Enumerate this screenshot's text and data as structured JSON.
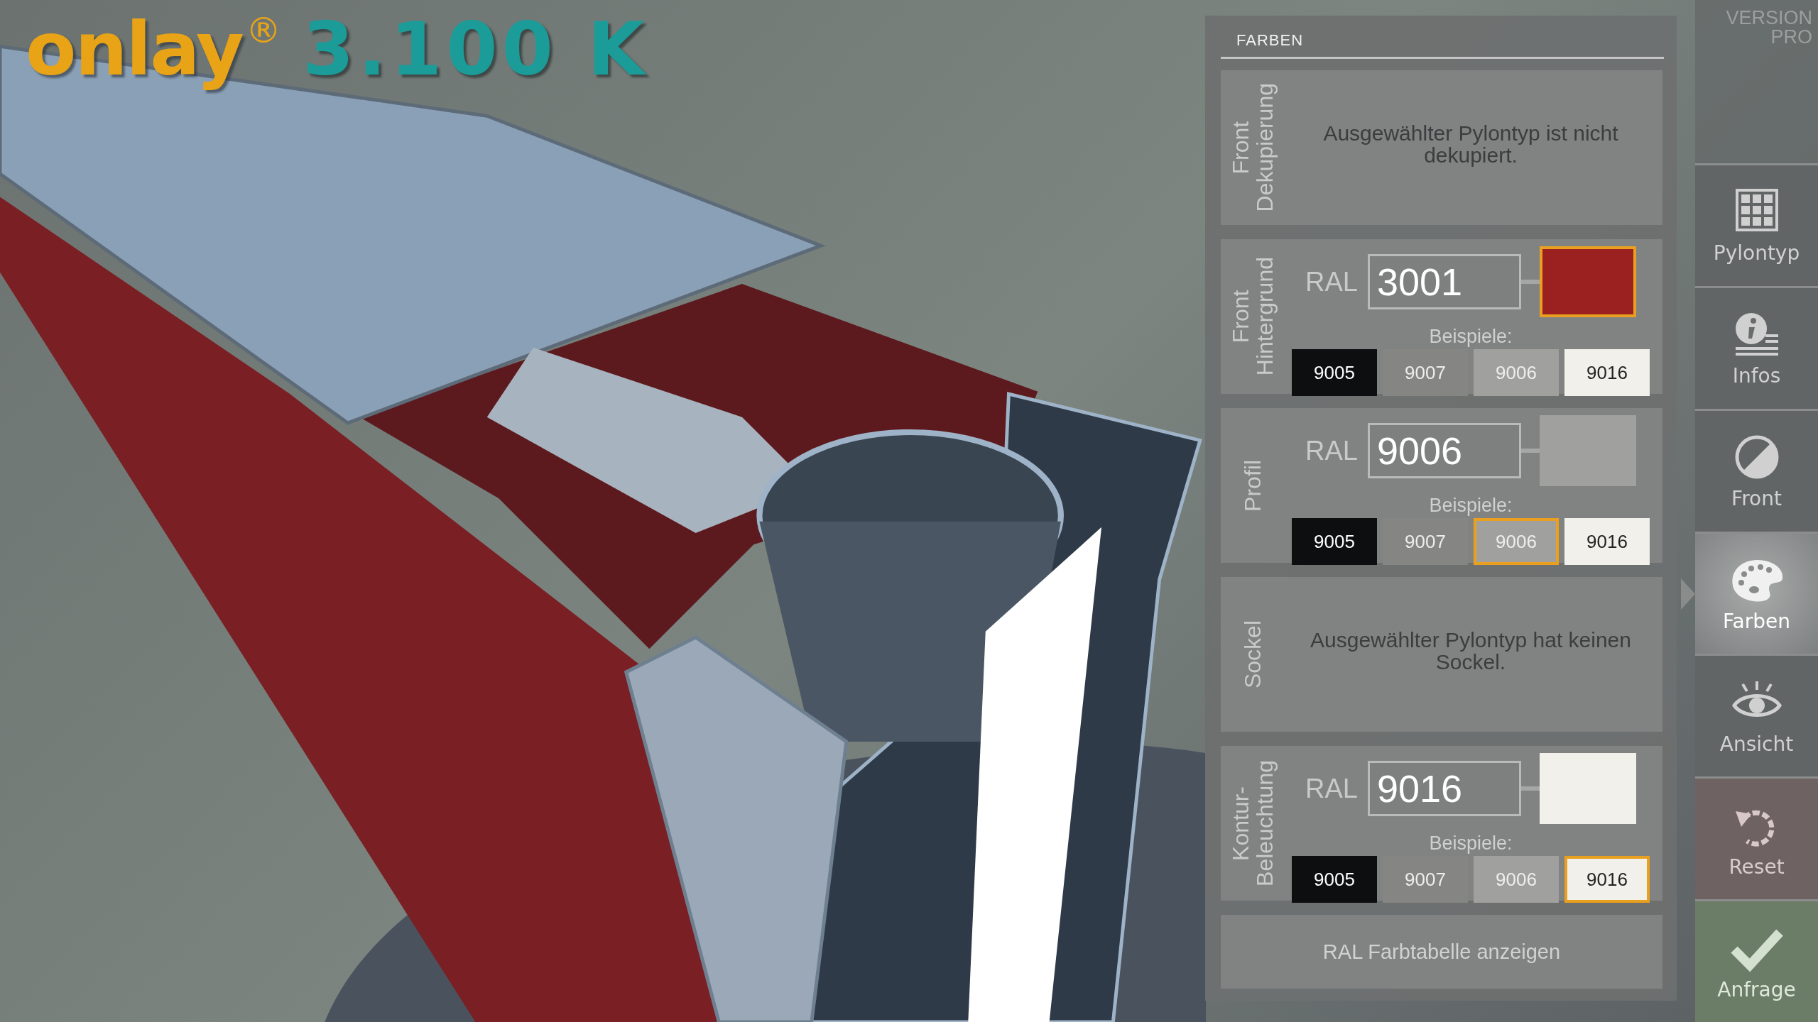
{
  "logo": {
    "brand": "onlay",
    "mark": "®",
    "model": "3.100 K"
  },
  "edition": [
    "VERSION",
    "PRO"
  ],
  "panel": {
    "title": "FARBEN",
    "sections": [
      {
        "kind": "message",
        "label": [
          "Front",
          "Dekupierung"
        ],
        "message": "Ausgewählter Pylontyp ist nicht dekupiert."
      },
      {
        "kind": "color",
        "label": [
          "Front",
          "Hintergrund"
        ],
        "ral_label": "RAL",
        "value": "3001",
        "color": "#9b2121",
        "swatch_selected": true,
        "examples_label": "Beispiele:",
        "examples": [
          {
            "label": "9005",
            "color": "#0d0e10",
            "selected": false
          },
          {
            "label": "9007",
            "color": "#858583",
            "selected": false
          },
          {
            "label": "9006",
            "color": "#a0a19f",
            "selected": false
          },
          {
            "label": "9016",
            "color": "#f1f0ea",
            "selected": false
          }
        ]
      },
      {
        "kind": "color",
        "label": [
          "Profil"
        ],
        "ral_label": "RAL",
        "value": "9006",
        "color": "#a0a19f",
        "swatch_selected": false,
        "examples_label": "Beispiele:",
        "examples": [
          {
            "label": "9005",
            "color": "#0d0e10",
            "selected": false
          },
          {
            "label": "9007",
            "color": "#858583",
            "selected": false
          },
          {
            "label": "9006",
            "color": "#a0a19f",
            "selected": true
          },
          {
            "label": "9016",
            "color": "#f1f0ea",
            "selected": false
          }
        ]
      },
      {
        "kind": "message",
        "label": [
          "Sockel"
        ],
        "message": "Ausgewählter Pylontyp hat keinen Sockel."
      },
      {
        "kind": "color",
        "label": [
          "Kontur-",
          "Beleuchtung"
        ],
        "ral_label": "RAL",
        "value": "9016",
        "color": "#f1f0ea",
        "swatch_selected": false,
        "examples_label": "Beispiele:",
        "examples": [
          {
            "label": "9005",
            "color": "#0d0e10",
            "selected": false
          },
          {
            "label": "9007",
            "color": "#858583",
            "selected": false
          },
          {
            "label": "9006",
            "color": "#a0a19f",
            "selected": false
          },
          {
            "label": "9016",
            "color": "#f1f0ea",
            "selected": true
          }
        ]
      }
    ],
    "table_button": "RAL Farbtabelle anzeigen"
  },
  "nav": [
    {
      "kind": "nav",
      "label": "Pylontyp",
      "selected": false
    },
    {
      "kind": "nav",
      "label": "Infos",
      "selected": false
    },
    {
      "kind": "nav",
      "label": "Front",
      "selected": false
    },
    {
      "kind": "nav",
      "label": "Farben",
      "selected": true
    },
    {
      "kind": "nav",
      "label": "Ansicht",
      "selected": false
    },
    {
      "kind": "reset",
      "label": "Reset",
      "selected": false
    },
    {
      "kind": "submit",
      "label": "Anfrage",
      "selected": false
    }
  ]
}
